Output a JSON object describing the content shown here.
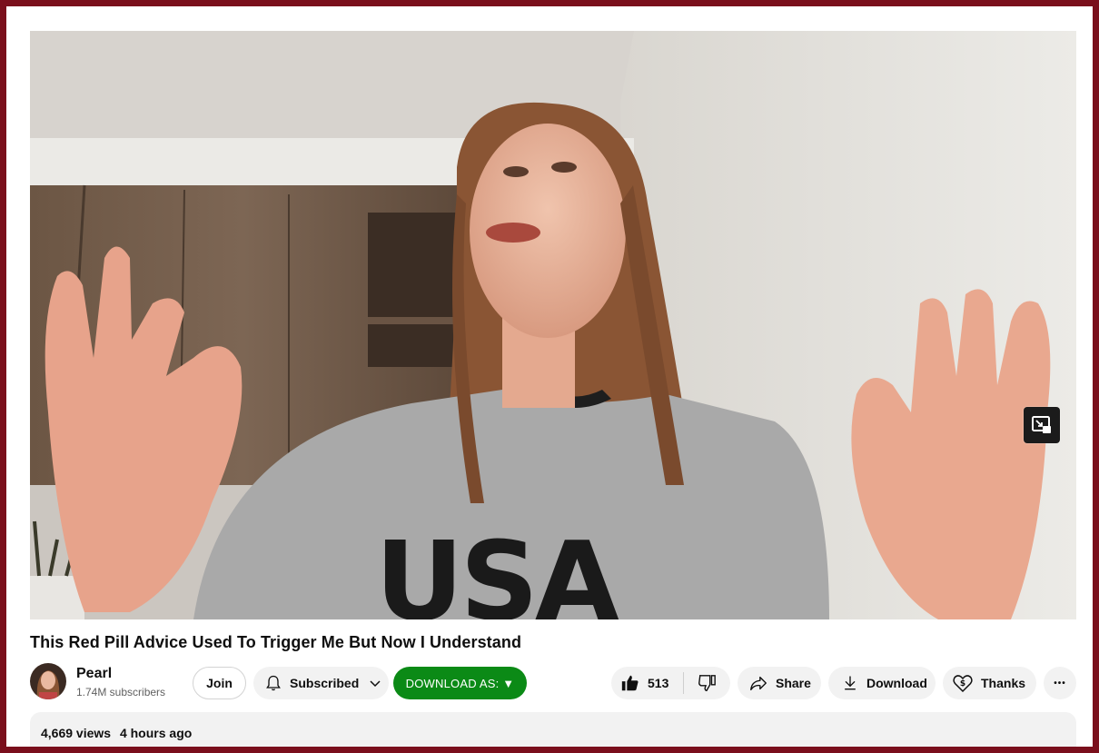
{
  "video": {
    "title": "This Red Pill Advice Used To Trigger Me But Now I Understand",
    "sweatshirt_text": "USA"
  },
  "channel": {
    "name": "Pearl",
    "subscribers": "1.74M subscribers"
  },
  "actions": {
    "join_label": "Join",
    "subscribed_label": "Subscribed",
    "download_as_label": "DOWNLOAD AS: ▼",
    "like_count": "513",
    "share_label": "Share",
    "download_label": "Download",
    "thanks_label": "Thanks",
    "more_label": "•••"
  },
  "description": {
    "views": "4,669 views",
    "age": "4 hours ago"
  },
  "icons": {
    "miniplayer": "miniplayer-icon",
    "bell": "bell-icon",
    "chevron": "chevron-down-icon",
    "like": "thumbs-up-icon",
    "dislike": "thumbs-down-icon",
    "share": "share-arrow-icon",
    "download": "download-icon",
    "thanks": "heart-dollar-icon",
    "more": "more-horizontal-icon"
  },
  "colors": {
    "page_frame": "#7a0f1c",
    "download_as_button": "#0b8a16",
    "pill_background": "#f2f2f2"
  }
}
